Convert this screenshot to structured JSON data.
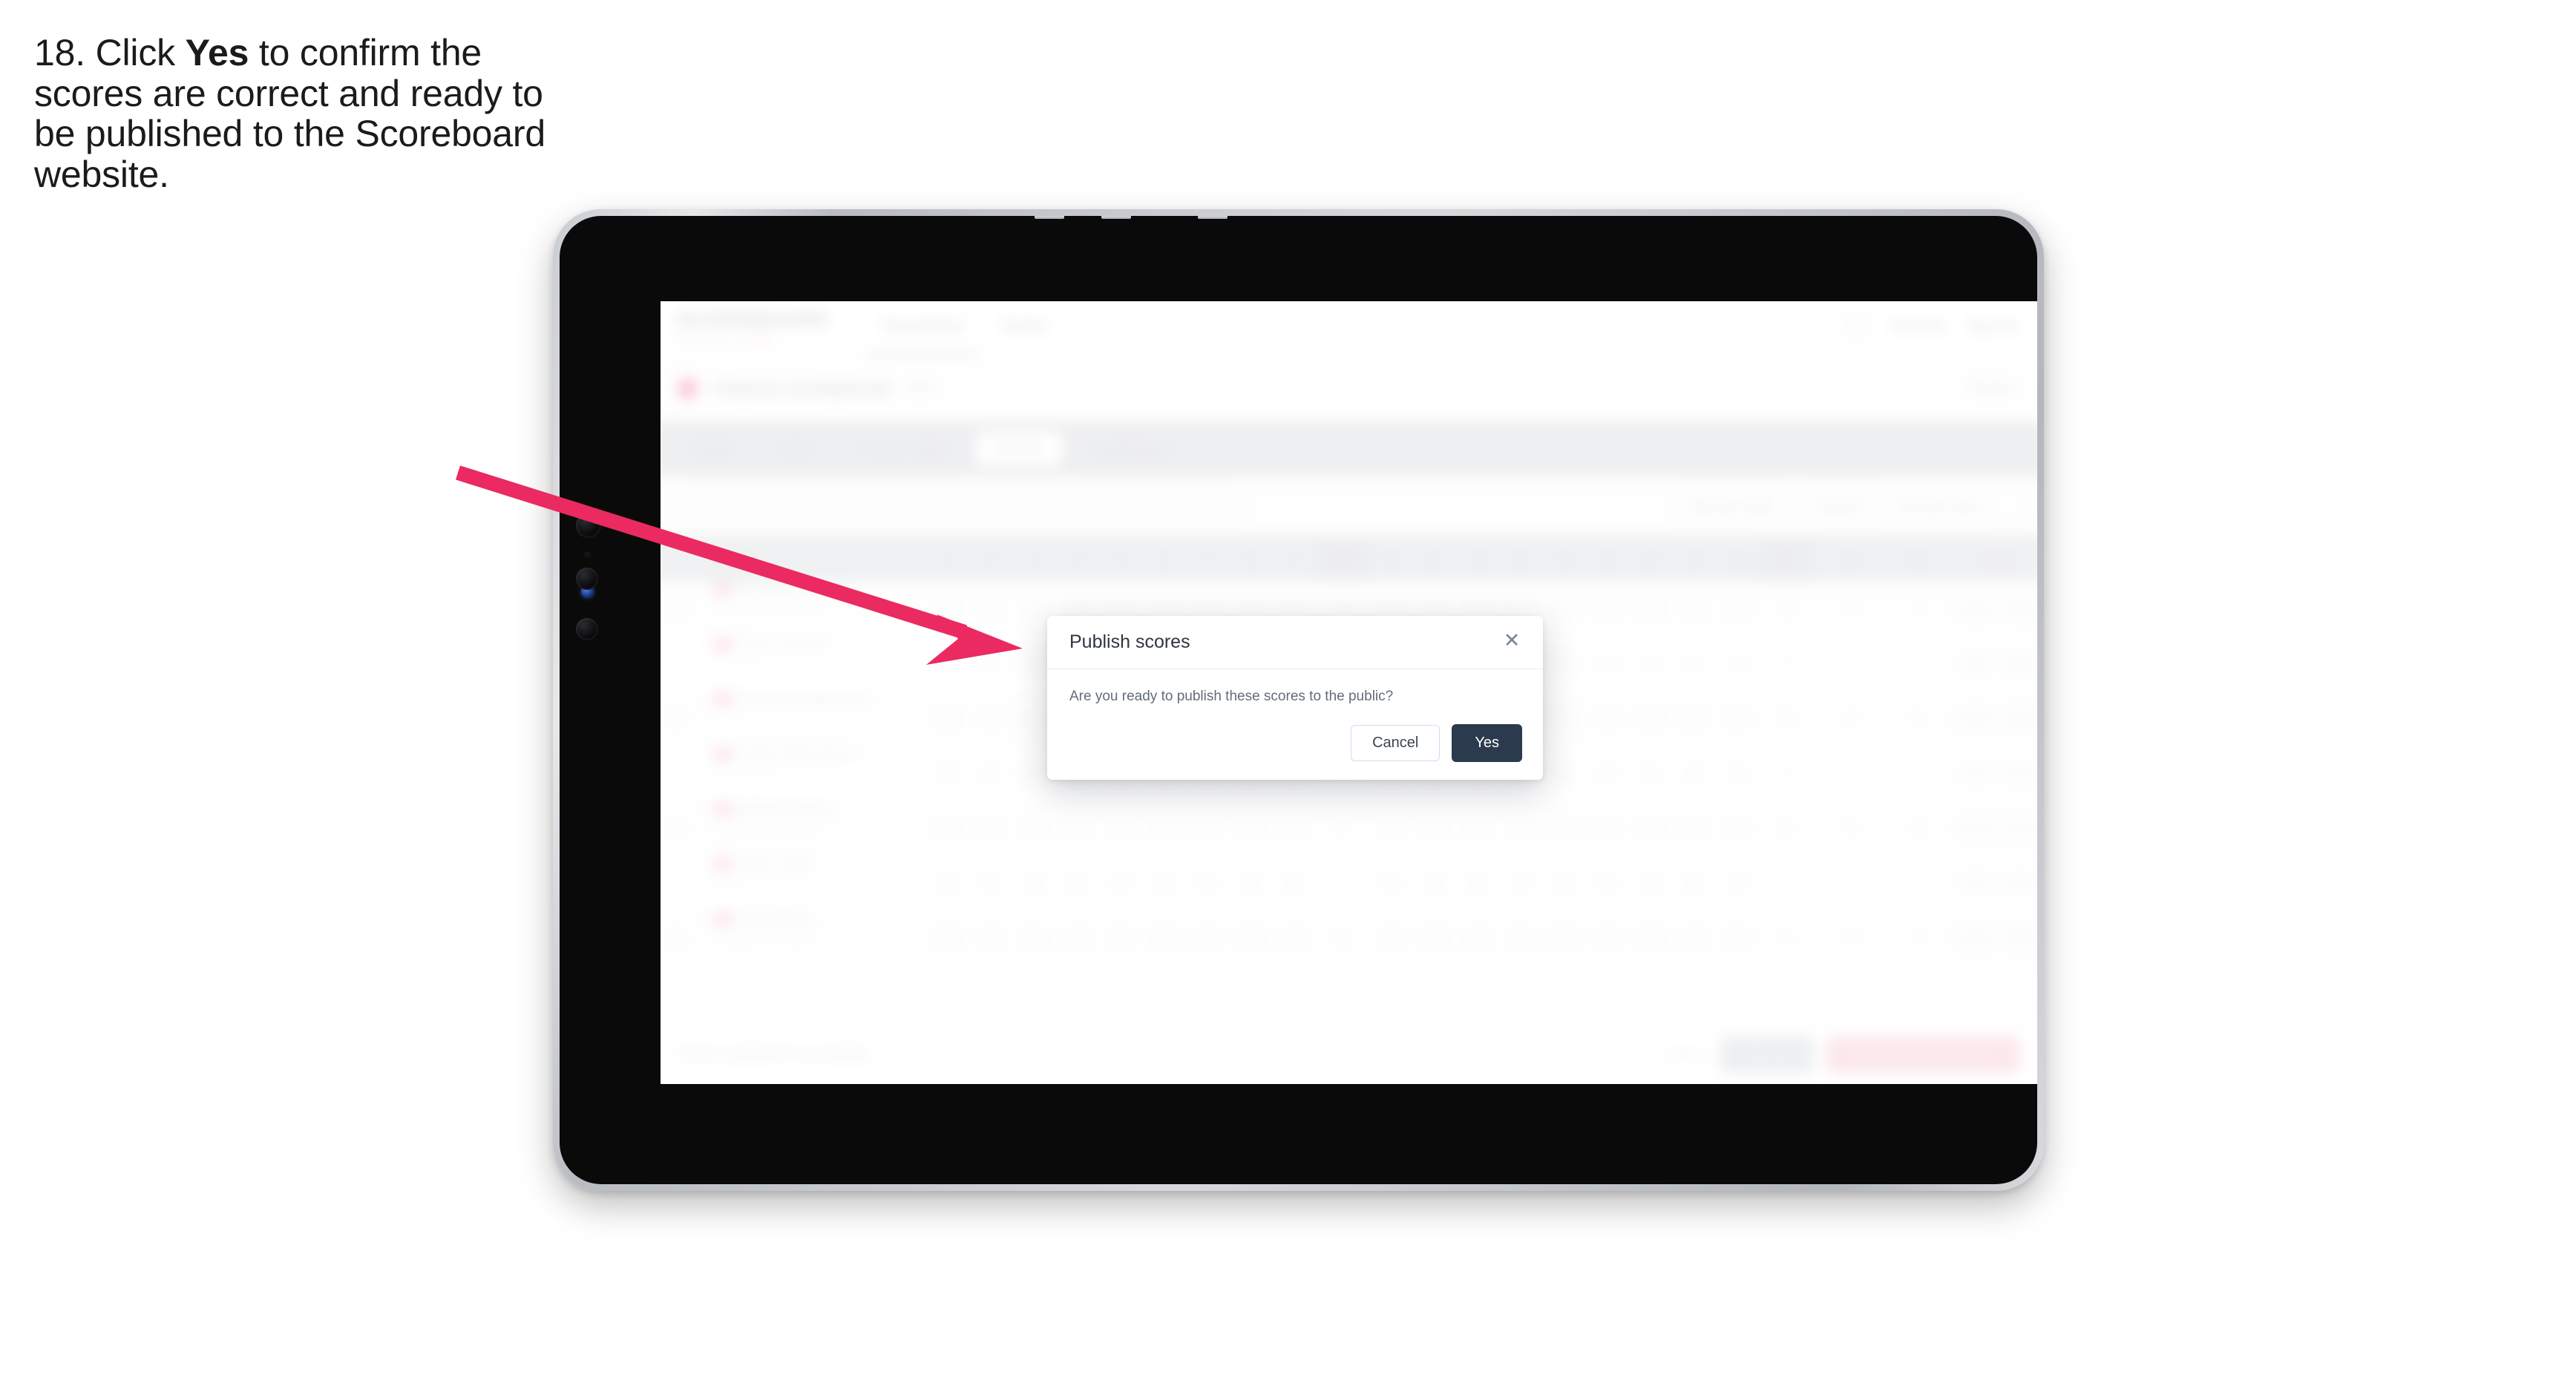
{
  "caption": {
    "prefix": "18. Click ",
    "emphasis": "Yes",
    "suffix": " to confirm the scores are correct and ready to be published to the Scoreboard website."
  },
  "annotation": {
    "arrow_color": "#ea2a60",
    "arrow_name": "pointer-arrow"
  },
  "device": {
    "name": "tablet-mockup",
    "frame_color": "#c9ccd0",
    "screen_color": "#0a0a0a"
  },
  "app": {
    "nav": {
      "brand": "SCOREBOARD",
      "brand_sub_left": "POWERED BY",
      "brand_sub_mark": "GOLF",
      "links": [
        {
          "label": "Tournaments",
          "active": true
        },
        {
          "label": "Events",
          "active": false
        }
      ],
      "user": "Test User",
      "signout": "Sign out"
    },
    "event": {
      "title": "Classic Invitational",
      "tag": "2024",
      "right_meta": "Round 1"
    },
    "tabs": [
      {
        "label": "Details",
        "active": false
      },
      {
        "label": "Draw",
        "active": false
      },
      {
        "label": "Course Setup",
        "active": false
      },
      {
        "label": "Results",
        "active": true
      },
      {
        "label": "Leaderboard",
        "active": false
      }
    ],
    "toolbar": {
      "search_placeholder": "Search players",
      "filters": [
        {
          "label": "Filter by round"
        },
        {
          "label": "Round 1"
        }
      ],
      "sort_label": "Sort by Order",
      "icon_button": "filter-icon"
    },
    "table": {
      "columns": [
        "Player",
        "1",
        "2",
        "3",
        "4",
        "5",
        "6",
        "7",
        "8",
        "9",
        "OUT",
        "10",
        "11",
        "12",
        "13",
        "14",
        "15",
        "16",
        "17",
        "18",
        "IN",
        "Tot",
        "Par",
        "Score"
      ],
      "rows": [
        {
          "player": "Matthew Thornton",
          "club": "Oakmont Country Club",
          "holes_out": [
            "4",
            "5",
            "4",
            "3",
            "4",
            "5",
            "4",
            "3",
            "4"
          ],
          "out": "36",
          "holes_in": [
            "4",
            "4",
            "5",
            "3",
            "4",
            "4",
            "5",
            "3",
            "4"
          ],
          "in": "36",
          "total": "72",
          "par": "72",
          "score": "E"
        },
        {
          "player": "Oliver Parnell",
          "club": "Carnoustie Links",
          "holes_out": [
            "5",
            "4",
            "4",
            "3",
            "5",
            "4",
            "4",
            "3",
            "4"
          ],
          "out": "36",
          "holes_in": [
            "4",
            "5",
            "4",
            "4",
            "3",
            "4",
            "5",
            "3",
            "4"
          ],
          "in": "36",
          "total": "72",
          "par": "72",
          "score": "E"
        },
        {
          "player": "Cameron Robertson",
          "club": "",
          "holes_out": [
            "4",
            "4",
            "5",
            "3",
            "4",
            "5",
            "4",
            "4",
            "4"
          ],
          "out": "37",
          "holes_in": [
            "4",
            "4",
            "4",
            "3",
            "5",
            "4",
            "4",
            "3",
            "5"
          ],
          "in": "36",
          "total": "73",
          "par": "72",
          "score": "+1"
        },
        {
          "player": "Calvin Richardson",
          "club": "Royal Birkdale Golf Club",
          "holes_out": [
            "4",
            "5",
            "4",
            "4",
            "4",
            "4",
            "5",
            "3",
            "4"
          ],
          "out": "37",
          "holes_in": [
            "5",
            "4",
            "4",
            "3",
            "4",
            "5",
            "4",
            "3",
            "4"
          ],
          "in": "36",
          "total": "73",
          "par": "72",
          "score": "+1"
        },
        {
          "player": "William Hearst",
          "club": "Sunningdale Golf Club",
          "holes_out": [
            "4",
            "4",
            "4",
            "3",
            "5",
            "5",
            "4",
            "4",
            "4"
          ],
          "out": "37",
          "holes_in": [
            "4",
            "5",
            "4",
            "4",
            "4",
            "4",
            "4",
            "4",
            "4"
          ],
          "in": "37",
          "total": "74",
          "par": "72",
          "score": "+2"
        },
        {
          "player": "Ryan Smith",
          "club": "Muirfield Golf Links",
          "holes_out": [
            "5",
            "4",
            "4",
            "4",
            "4",
            "5",
            "4",
            "3",
            "4"
          ],
          "out": "37",
          "holes_in": [
            "4",
            "4",
            "5",
            "4",
            "4",
            "4",
            "5",
            "3",
            "4"
          ],
          "in": "37",
          "total": "74",
          "par": "72",
          "score": "+2"
        },
        {
          "player": "Alex Bailey",
          "club": "Turnberry Golf Resort",
          "holes_out": [
            "4",
            "5",
            "5",
            "3",
            "4",
            "5",
            "4",
            "4",
            "4"
          ],
          "out": "38",
          "holes_in": [
            "4",
            "4",
            "4",
            "4",
            "5",
            "4",
            "5",
            "3",
            "4"
          ],
          "in": "37",
          "total": "75",
          "par": "72",
          "score": "+3"
        }
      ]
    },
    "bottom": {
      "note": "Scores published successfully",
      "cancel_link": "Cancel",
      "save_label": "Save all",
      "publish_label": "Publish scores to public"
    }
  },
  "dialog": {
    "title": "Publish scores",
    "message": "Are you ready to publish these scores to the public?",
    "cancel_label": "Cancel",
    "confirm_label": "Yes",
    "close_glyph": "✕",
    "accent_dark": "#2b3a4d",
    "cancel_border": "#cfdcf2"
  }
}
